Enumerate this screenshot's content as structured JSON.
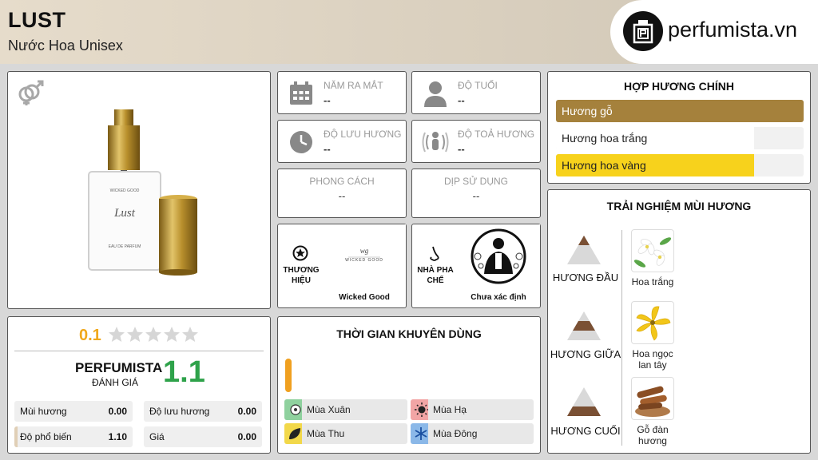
{
  "header": {
    "title": "LUST",
    "subtitle": "Nước Hoa Unisex",
    "logo_text": "perfumista.vn"
  },
  "info": {
    "release": {
      "label": "NĂM RA MẮT",
      "value": "--"
    },
    "age": {
      "label": "ĐỘ TUỔI",
      "value": "--"
    },
    "longevity": {
      "label": "ĐỘ LƯU HƯƠNG",
      "value": "--"
    },
    "sillage": {
      "label": "ĐỘ TOẢ HƯƠNG",
      "value": "--"
    },
    "style": {
      "label": "PHONG CÁCH",
      "value": "--"
    },
    "occasion": {
      "label": "DỊP SỬ DỤNG",
      "value": "--"
    }
  },
  "brand": {
    "label_line1": "THƯƠNG",
    "label_line2": "HIỆU",
    "name": "Wicked Good",
    "logo_text": "WICKED GOOD"
  },
  "perfumer": {
    "label_line1": "NHÀ PHA",
    "label_line2": "CHẾ",
    "name": "Chưa xác định"
  },
  "bottle": {
    "brand_line": "WICKED GOOD",
    "script_name": "Lust",
    "type_line": "EAU DE PARFUM"
  },
  "accords": {
    "title": "HỢP HƯƠNG CHÍNH",
    "items": [
      {
        "label": "Hương gỗ",
        "fill": 1.0,
        "color": "#a5813c",
        "text_color": "#ffffff"
      },
      {
        "label": "Hương hoa trắng",
        "fill": 0.8,
        "color": "#ffffff",
        "text_color": "#222222"
      },
      {
        "label": "Hương hoa vàng",
        "fill": 0.8,
        "color": "#f7d21c",
        "text_color": "#222222"
      }
    ]
  },
  "notes": {
    "title": "TRẢI NGHIỆM MÙI HƯƠNG",
    "top": {
      "label": "HƯƠNG ĐẦU",
      "note_line1": "Hoa trắng",
      "note_line2": ""
    },
    "middle": {
      "label": "HƯƠNG GIỮA",
      "note_line1": "Hoa ngọc",
      "note_line2": "lan tây"
    },
    "base": {
      "label": "HƯƠNG CUỐI",
      "note_line1": "Gỗ đàn",
      "note_line2": "hương"
    }
  },
  "rating": {
    "user_score": "0.1",
    "stars_filled": 0,
    "brand": "PERFUMISTA",
    "rating_label": "ĐÁNH GIÁ",
    "perfumista_score": "1.1",
    "stats": [
      {
        "label": "Mùi hương",
        "value": "0.00"
      },
      {
        "label": "Độ lưu hương",
        "value": "0.00"
      },
      {
        "label": "Độ phổ biến",
        "value": "1.10"
      },
      {
        "label": "Giá",
        "value": "0.00"
      }
    ]
  },
  "usage": {
    "title": "THỜI GIAN KHUYÊN DÙNG",
    "day_level": 0.8,
    "seasons": [
      {
        "label": "Mùa Xuân",
        "color": "#8fd19e"
      },
      {
        "label": "Mùa Hạ",
        "color": "#f2a5a5"
      },
      {
        "label": "Mùa Thu",
        "color": "#f2d84a"
      },
      {
        "label": "Mùa Đông",
        "color": "#8bb8e8"
      }
    ]
  }
}
